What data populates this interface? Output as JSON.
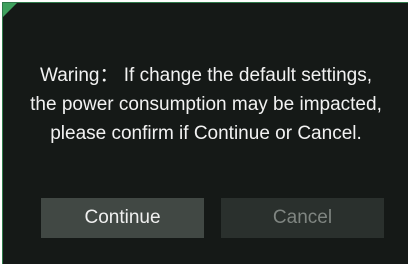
{
  "dialog": {
    "message_lines": [
      "Waring： If change the default settings,",
      "the power consumption may be impacted,",
      "please confirm if Continue or Cancel."
    ],
    "continue_label": "Continue",
    "cancel_label": "Cancel"
  },
  "colors": {
    "background": "#151917",
    "accent": "#3fa05e",
    "continue_button": "#414844",
    "cancel_button": "#2a302d"
  }
}
